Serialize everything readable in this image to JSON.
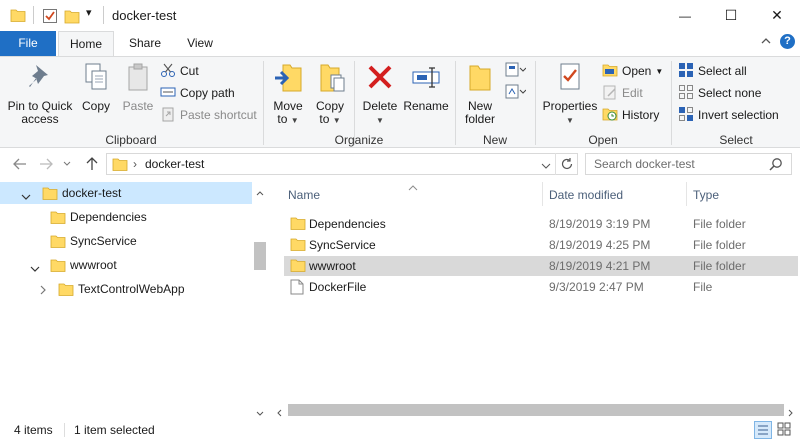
{
  "titlebar": {
    "title": "docker-test",
    "qa_dropdown_glyph": "▾",
    "minimize_glyph": "—",
    "maximize_glyph": "☐",
    "close_glyph": "✕"
  },
  "ribbon_tabs": [
    "File",
    "Home",
    "Share",
    "View"
  ],
  "ribbon_help": "?",
  "clipboard": {
    "pin": "Pin to Quick access",
    "pin_l1": "Pin to Quick",
    "pin_l2": "access",
    "copy": "Copy",
    "paste": "Paste",
    "cut": "Cut",
    "copy_path": "Copy path",
    "paste_shortcut": "Paste shortcut",
    "label": "Clipboard"
  },
  "organize": {
    "move_to": "Move to",
    "move_l1": "Move",
    "move_l2": "to",
    "copy_to": "Copy to",
    "copy_l1": "Copy",
    "copy_l2": "to",
    "delete": "Delete",
    "rename": "Rename",
    "label": "Organize"
  },
  "new_group": {
    "new_folder_l1": "New",
    "new_folder_l2": "folder",
    "label": "New"
  },
  "open_group": {
    "properties": "Properties",
    "open": "Open",
    "edit": "Edit",
    "history": "History",
    "label": "Open"
  },
  "select_group": {
    "select_all": "Select all",
    "select_none": "Select none",
    "invert": "Invert selection",
    "label": "Select"
  },
  "address": {
    "path_separator": "›",
    "path": "docker-test",
    "search_placeholder": "Search docker-test"
  },
  "nav_tree": [
    {
      "label": "docker-test",
      "expanded": true,
      "selected": true
    },
    {
      "label": "Dependencies"
    },
    {
      "label": "SyncService"
    },
    {
      "label": "wwwroot",
      "expanded": true
    },
    {
      "label": "TextControlWebApp",
      "expanded": false
    }
  ],
  "columns": {
    "name": "Name",
    "date": "Date modified",
    "type": "Type"
  },
  "files": [
    {
      "name": "Dependencies",
      "date": "8/19/2019 3:19 PM",
      "type": "File folder",
      "icon": "folder-icon"
    },
    {
      "name": "SyncService",
      "date": "8/19/2019 4:25 PM",
      "type": "File folder",
      "icon": "folder-icon"
    },
    {
      "name": "wwwroot",
      "date": "8/19/2019 4:21 PM",
      "type": "File folder",
      "icon": "folder-icon",
      "selected": true
    },
    {
      "name": "DockerFile",
      "date": "9/3/2019 2:47 PM",
      "type": "File",
      "icon": "file-icon"
    }
  ],
  "status": {
    "items": "4 items",
    "selected": "1 item selected"
  },
  "colors": {
    "file_tab": "#1f6fc5",
    "selected_tree": "#cce8ff",
    "selected_row": "#d9d9d9",
    "folder": "#ffd965"
  }
}
